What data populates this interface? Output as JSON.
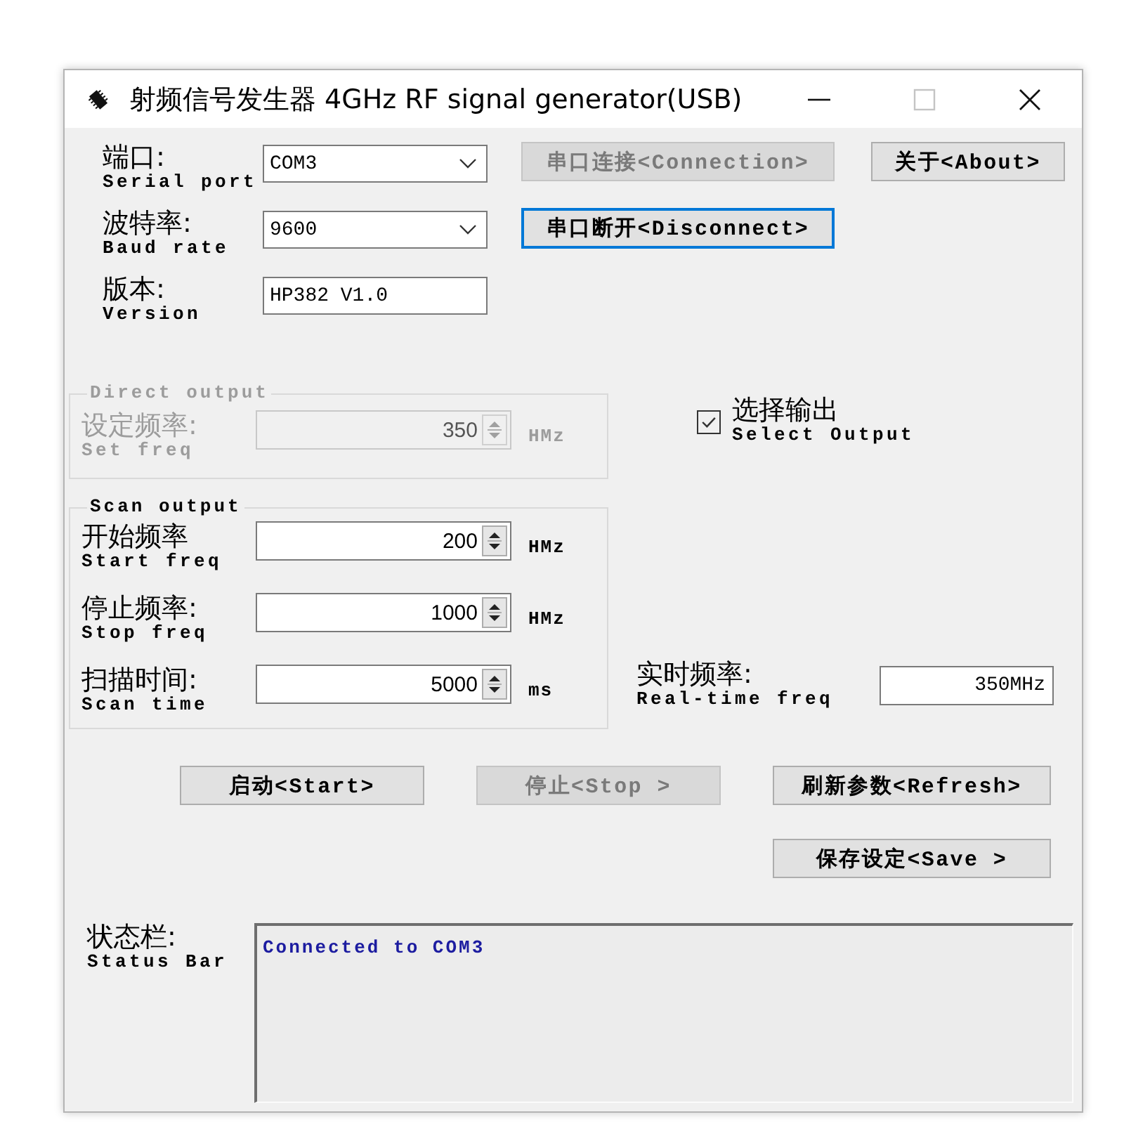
{
  "window": {
    "title": "射频信号发生器 4GHz RF signal generator(USB)",
    "controls": [
      {
        "kind": "minimize",
        "disabled": false
      },
      {
        "kind": "maximize",
        "disabled": true
      },
      {
        "kind": "close",
        "disabled": false
      }
    ]
  },
  "settings": [
    {
      "kind": "combo",
      "label": "端口:",
      "label_en": "Serial port",
      "value": "COM3"
    },
    {
      "kind": "combo",
      "label": "波特率:",
      "label_en": "Baud rate",
      "value": "9600"
    },
    {
      "kind": "text",
      "label": "版本:",
      "label_en": "Version",
      "value": "HP382 V1.0"
    }
  ],
  "connect_buttons": [
    {
      "label": "串口连接<Connection>",
      "disabled": true,
      "focused": false
    },
    {
      "label": "串口断开<Disconnect>",
      "disabled": false,
      "focused": true
    }
  ],
  "about_button": {
    "label": "关于<About>"
  },
  "direct_output": {
    "title": "Direct output",
    "disabled": true,
    "label": "设定频率:",
    "label_en": "Set freq",
    "value": "350",
    "unit": "HMz"
  },
  "select_output": {
    "label": "选择输出",
    "label_en": "Select Output",
    "checked": true
  },
  "scan_output": {
    "title": "Scan output",
    "disabled": false,
    "rows": [
      {
        "label": "开始频率",
        "label_en": "Start freq",
        "value": "200",
        "unit": "HMz"
      },
      {
        "label": "停止频率:",
        "label_en": "Stop freq",
        "value": "1000",
        "unit": "HMz"
      },
      {
        "label": "扫描时间:",
        "label_en": "Scan time",
        "value": "5000",
        "unit": "ms"
      }
    ]
  },
  "realtime_freq": {
    "label": "实时频率:",
    "label_en": "Real-time freq",
    "value": "350MHz"
  },
  "action_buttons": [
    {
      "label": "启动<Start>",
      "disabled": false
    },
    {
      "label": "停止<Stop >",
      "disabled": true
    },
    {
      "label": "刷新参数<Refresh>",
      "disabled": false
    },
    {
      "label": "保存设定<Save >",
      "disabled": false
    }
  ],
  "status_bar": {
    "label": "状态栏:",
    "label_en": "Status Bar",
    "message": "Connected to COM3"
  }
}
